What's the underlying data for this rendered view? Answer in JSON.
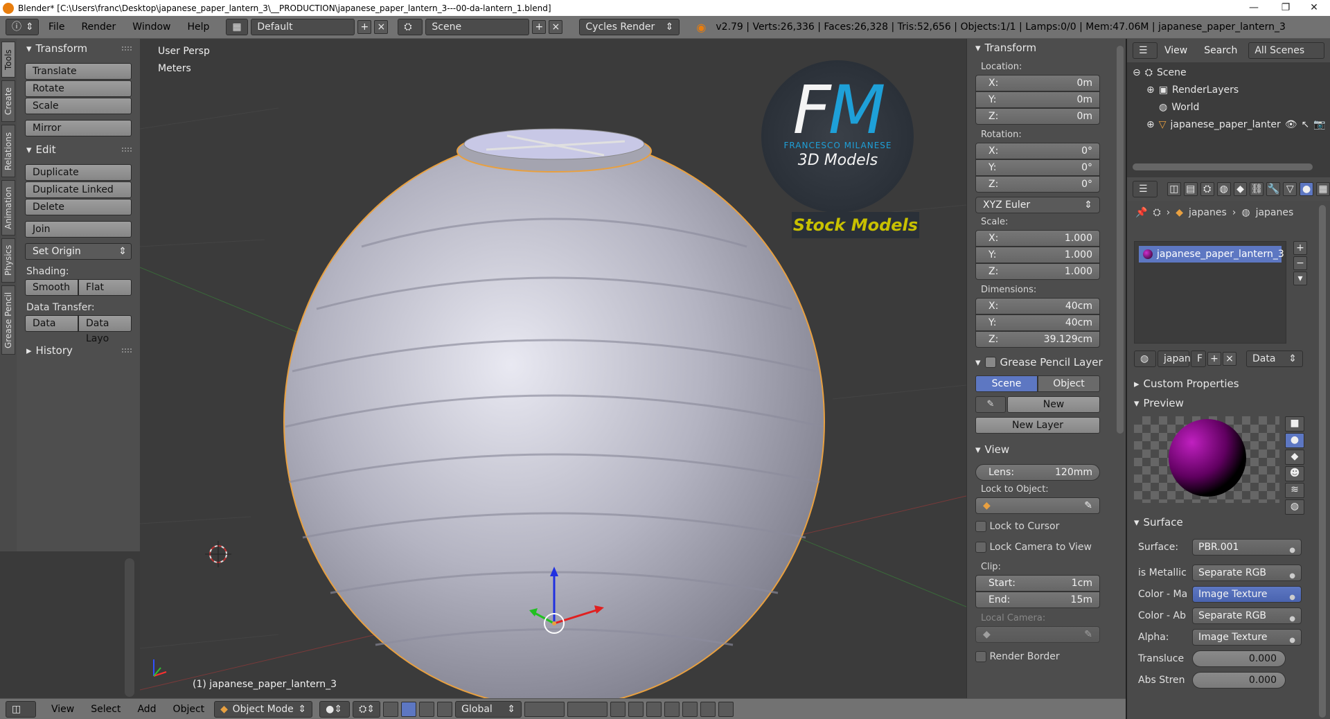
{
  "titlebar": {
    "title": "Blender* [C:\\Users\\franc\\Desktop\\japanese_paper_lantern_3\\__PRODUCTION\\japanese_paper_lantern_3---00-da-lantern_1.blend]",
    "minimize": "—",
    "maximize": "❐",
    "close": "✕"
  },
  "topbar": {
    "menus": [
      "File",
      "Render",
      "Window",
      "Help"
    ],
    "layout": "Default",
    "scene": "Scene",
    "engine": "Cycles Render",
    "stats": "v2.79 | Verts:26,336 | Faces:26,328 | Tris:52,656 | Objects:1/1 | Lamps:0/0 | Mem:47.06M | japanese_paper_lantern_3"
  },
  "tabs": [
    "Tools",
    "Create",
    "Relations",
    "Animation",
    "Physics",
    "Grease Pencil"
  ],
  "tools": {
    "transform_title": "Transform",
    "translate": "Translate",
    "rotate": "Rotate",
    "scale": "Scale",
    "mirror": "Mirror",
    "edit_title": "Edit",
    "duplicate": "Duplicate",
    "duplicate_linked": "Duplicate Linked",
    "delete": "Delete",
    "join": "Join",
    "set_origin": "Set Origin",
    "shading_label": "Shading:",
    "smooth": "Smooth",
    "flat": "Flat",
    "data_transfer_label": "Data Transfer:",
    "data": "Data",
    "data_layo": "Data Layo",
    "history_title": "History"
  },
  "viewport": {
    "view_name": "User Persp",
    "units": "Meters",
    "object_label": "(1) japanese_paper_lantern_3",
    "watermark": {
      "initials": "FM",
      "author": "FRANCESCO MILANESE",
      "subtitle": "3D Models",
      "banner": "Stock Models"
    }
  },
  "npanel": {
    "transform_title": "Transform",
    "location_label": "Location:",
    "rotation_label": "Rotation:",
    "scale_label": "Scale:",
    "dimensions_label": "Dimensions:",
    "location": [
      {
        "axis": "X:",
        "value": "0m"
      },
      {
        "axis": "Y:",
        "value": "0m"
      },
      {
        "axis": "Z:",
        "value": "0m"
      }
    ],
    "rotation": [
      {
        "axis": "X:",
        "value": "0°"
      },
      {
        "axis": "Y:",
        "value": "0°"
      },
      {
        "axis": "Z:",
        "value": "0°"
      }
    ],
    "rotation_mode": "XYZ Euler",
    "scale": [
      {
        "axis": "X:",
        "value": "1.000"
      },
      {
        "axis": "Y:",
        "value": "1.000"
      },
      {
        "axis": "Z:",
        "value": "1.000"
      }
    ],
    "dimensions": [
      {
        "axis": "X:",
        "value": "40cm"
      },
      {
        "axis": "Y:",
        "value": "40cm"
      },
      {
        "axis": "Z:",
        "value": "39.129cm"
      }
    ],
    "grease_title": "Grease Pencil Layer",
    "gp_scene": "Scene",
    "gp_object": "Object",
    "gp_new": "New",
    "gp_new_layer": "New Layer",
    "view_title": "View",
    "lens_label": "Lens:",
    "lens_value": "120mm",
    "lock_to_object": "Lock to Object:",
    "lock_to_cursor": "Lock to Cursor",
    "lock_camera": "Lock Camera to View",
    "clip_label": "Clip:",
    "clip_start_label": "Start:",
    "clip_start": "1cm",
    "clip_end_label": "End:",
    "clip_end": "15m",
    "local_camera": "Local Camera:",
    "render_border": "Render Border"
  },
  "outliner": {
    "view": "View",
    "search": "Search",
    "filter": "All Scenes",
    "items": [
      {
        "label": "Scene"
      },
      {
        "label": "RenderLayers"
      },
      {
        "label": "World"
      },
      {
        "label": "japanese_paper_lanter"
      }
    ]
  },
  "properties": {
    "breadcrumb_1": "japanes",
    "breadcrumb_2": "japanes",
    "material_slot": "japanese_paper_lantern_3",
    "mat_name": "japan",
    "mat_f": "F",
    "data_select": "Data",
    "custom_properties": "Custom Properties",
    "preview": "Preview",
    "surface_title": "Surface",
    "rows": [
      {
        "label": "Surface:",
        "value": "PBR.001",
        "style": "normal"
      },
      {
        "label": "is Metallic",
        "value": "Separate RGB",
        "style": "normal"
      },
      {
        "label": "Color - Ma",
        "value": "Image Texture",
        "style": "blue"
      },
      {
        "label": "Color - Ab",
        "value": "Separate RGB",
        "style": "normal"
      },
      {
        "label": "Alpha:",
        "value": "Image Texture",
        "style": "normal"
      }
    ],
    "translucent_label": "Transluce",
    "translucent": "0.000",
    "abs_label": "Abs Stren",
    "abs": "0.000"
  },
  "bottombar": {
    "menus": [
      "View",
      "Select",
      "Add",
      "Object"
    ],
    "mode": "Object Mode",
    "orientation": "Global"
  },
  "colors": {
    "accent_blue": "#5d77c2",
    "selection_orange": "#e8a040",
    "watermark_cyan": "#1ea0d8",
    "banner_yellow": "#c8c000"
  }
}
